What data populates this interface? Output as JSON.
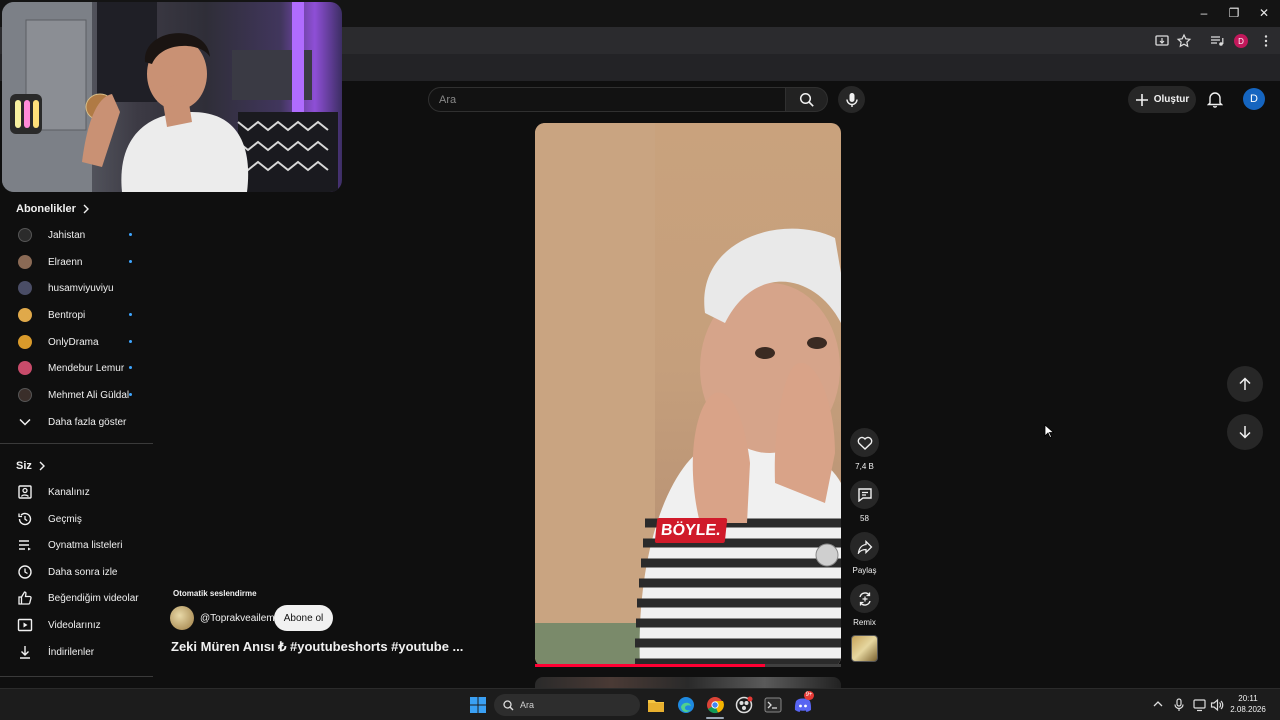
{
  "search": {
    "placeholder": "Ara"
  },
  "header": {
    "create_label": "Oluştur",
    "avatar_letter": "D"
  },
  "sidebar": {
    "subscriptions_title": "Abonelikler",
    "channels": [
      {
        "name": "Jahistan",
        "new": true,
        "color": "#2b2b2b"
      },
      {
        "name": "Elraenn",
        "new": true,
        "color": "#8a6a55"
      },
      {
        "name": "husamviyuviyu",
        "new": false,
        "color": "#4a4d66"
      },
      {
        "name": "Bentropi",
        "new": true,
        "color": "#e0a94a"
      },
      {
        "name": "OnlyDrama",
        "new": true,
        "color": "#d99a2b"
      },
      {
        "name": "Mendebur Lemur",
        "new": true,
        "color": "#c84b6a"
      },
      {
        "name": "Mehmet Ali Güldal",
        "new": true,
        "color": "#3a2e2a"
      }
    ],
    "show_more": "Daha fazla göster",
    "you_title": "Siz",
    "you_items": [
      {
        "label": "Kanalınız",
        "icon": "your-channel-icon"
      },
      {
        "label": "Geçmiş",
        "icon": "history-icon"
      },
      {
        "label": "Oynatma listeleri",
        "icon": "playlists-icon"
      },
      {
        "label": "Daha sonra izle",
        "icon": "watch-later-icon"
      },
      {
        "label": "Beğendiğim videolar",
        "icon": "liked-videos-icon"
      },
      {
        "label": "Videolarınız",
        "icon": "your-videos-icon"
      },
      {
        "label": "İndirilenler",
        "icon": "downloads-icon"
      }
    ]
  },
  "short": {
    "caption": "BÖYLE.",
    "progress": 0.75,
    "auto_dub_label": "Otomatik seslendirme",
    "channel_handle": "@Toprakveailem",
    "subscribe_label": "Abone ol",
    "title": "Zeki Müren Anısı ₺ #youtubeshorts #youtube ...",
    "likes": "7,4 B",
    "comments": "58",
    "share_label": "Paylaş",
    "remix_label": "Remix"
  },
  "taskbar": {
    "search_label": "Ara",
    "time": "20:11",
    "date": "2.08.2026",
    "discord_badge": "9+"
  },
  "colors": {
    "accent_red": "#ff0033",
    "avatar_blue": "#1565c0",
    "new_dot": "#3ea6ff"
  }
}
